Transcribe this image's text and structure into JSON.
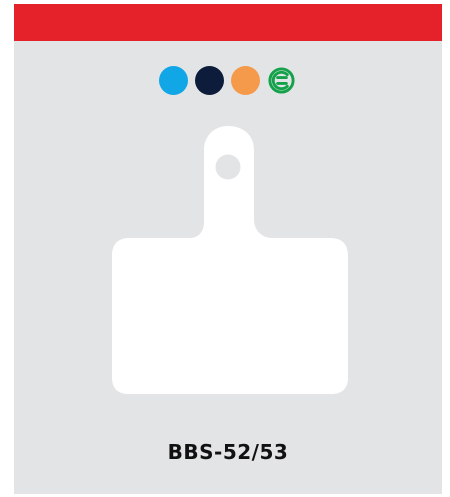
{
  "header": {
    "accent_color": "#e5222a"
  },
  "compound_indicators": [
    {
      "icon": "light-blue-dot-icon",
      "color": "#11a6e6"
    },
    {
      "icon": "navy-dot-icon",
      "color": "#0c1c3a"
    },
    {
      "icon": "orange-dot-icon",
      "color": "#f59a4b"
    },
    {
      "icon": "e-bike-icon",
      "color": "#13a24a"
    }
  ],
  "product": {
    "model": "BBS-52/53",
    "pad_color": "#ffffff",
    "background_color": "#e3e4e6"
  }
}
